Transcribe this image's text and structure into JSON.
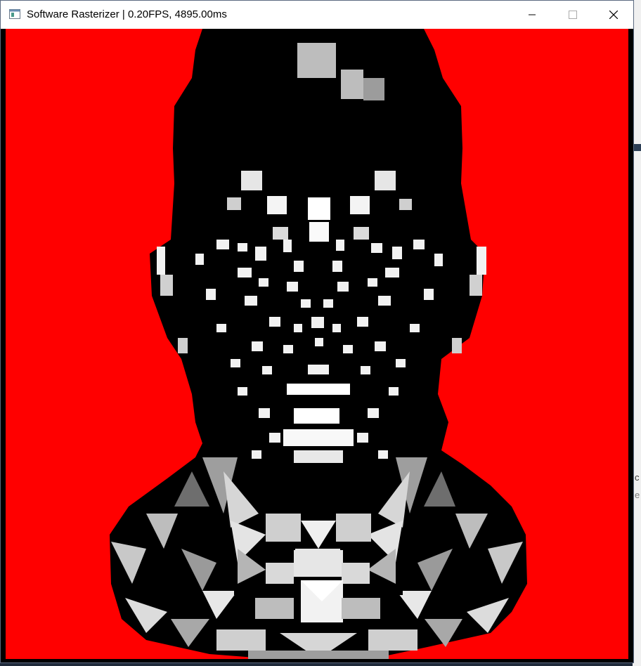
{
  "window": {
    "title": "Software Rasterizer | 0.20FPS, 4895.00ms",
    "icons": {
      "app": "window-app-icon",
      "minimize": "minimize-icon",
      "maximize": "maximize-icon",
      "close": "close-icon"
    }
  },
  "viewport": {
    "background_color": "#ff0000",
    "content": "rendered-head-mesh"
  },
  "background": {
    "right_glyph_1": "c",
    "right_glyph_2": "e"
  }
}
